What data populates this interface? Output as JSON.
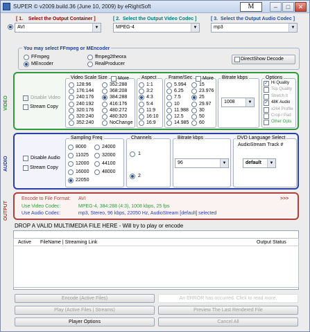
{
  "window": {
    "title": "SUPER © v2009.build.36 (June 10, 2009) by eRightSoft",
    "m_button": "M",
    "min": "–",
    "max": "□",
    "close": "✕"
  },
  "steps": {
    "n1": "[ 1.",
    "t1": "Select the Output Container ]",
    "n2": "[ 2.",
    "t2": "Select the Output Video Codec ]",
    "n3": "[ 3.",
    "t3": "Select the Output Audio Codec ]",
    "container": "AVI",
    "video_codec": "MPEG-4",
    "audio_codec": "mp3"
  },
  "encoder": {
    "title": "You may select FFmpeg or MEncoder",
    "ffmpeg": "FFmpeg",
    "ffmpeg2theora": "ffmpeg2theora",
    "mencoder": "MEncoder",
    "realproducer": "RealProducer",
    "directshow": "DirectShow Decode"
  },
  "video": {
    "label": "VIDEO",
    "disable": "Disable Video",
    "stream_copy": "Stream Copy",
    "scale_title": "Video Scale Size",
    "more": "More",
    "sizes": [
      "128:96",
      "176:144",
      "240:176",
      "240:192",
      "320:176",
      "320:240",
      "352:240",
      "352:288",
      "368:208",
      "384:288",
      "416:176",
      "480:272",
      "480:320",
      "NoChange"
    ],
    "aspect_title": "Aspect",
    "aspects": [
      "1:1",
      "3:2",
      "4:3",
      "5:4",
      "11:9",
      "16:10",
      "16:9"
    ],
    "fps_title": "Frame/Sec",
    "fps": [
      "5.994",
      "6.25",
      "7.5",
      "10",
      "11.988",
      "12.5",
      "14.985",
      "15",
      "23.976",
      "25",
      "29.97",
      "30",
      "50",
      "60"
    ],
    "bitrate_title": "Bitrate  kbps",
    "bitrate": "1008",
    "options_title": "Options",
    "options": [
      "Hi Quality",
      "Top Quality",
      "Stretch It",
      "48K Audio",
      "x264 Profile",
      "Crop / Pad",
      "Other Opts"
    ]
  },
  "audio": {
    "label": "AUDIO",
    "disable": "Disable Audio",
    "stream_copy": "Stream Copy",
    "freq_title": "Sampling Freq",
    "freqs": [
      "8000",
      "11025",
      "12000",
      "16000",
      "22050",
      "24000",
      "32000",
      "44100",
      "48000"
    ],
    "channels_title": "Channels",
    "ch1": "1",
    "ch2": "2",
    "bitrate_title": "Bitrate  kbps",
    "bitrate": "96",
    "dvd_title": "DVD Language Select",
    "dvd_sub": "AudioStream  Track #",
    "dvd_value": "default"
  },
  "output": {
    "label": "OUTPUT",
    "format_label": "Encode to File Format:",
    "format_value": "AVI",
    "arrows": ">>>",
    "video_label": "Use Video Codec:",
    "video_value": "MPEG-4,  384:288 (4:3),  1008 kbps,  25 fps",
    "audio_label": "Use Audio Codec:",
    "audio_value": "mp3,  Stereo,  96 kbps,  22050 Hz,  AudioStream [default] selected"
  },
  "drop_text": "DROP A VALID MULTIMEDIA FILE HERE - Will try to play or encode",
  "table": {
    "col_active": "Active",
    "col_file": "FileName  |  Streaming Link",
    "col_status": "Output Status"
  },
  "buttons": {
    "encode": "Encode (Active Files)",
    "error": "An ERROR has occurred. Click to read more.",
    "play": "Play (Active Files | Streams)",
    "preview": "Preview The Last Rendered File",
    "options": "Player Options",
    "cancel": "Cancel All"
  }
}
